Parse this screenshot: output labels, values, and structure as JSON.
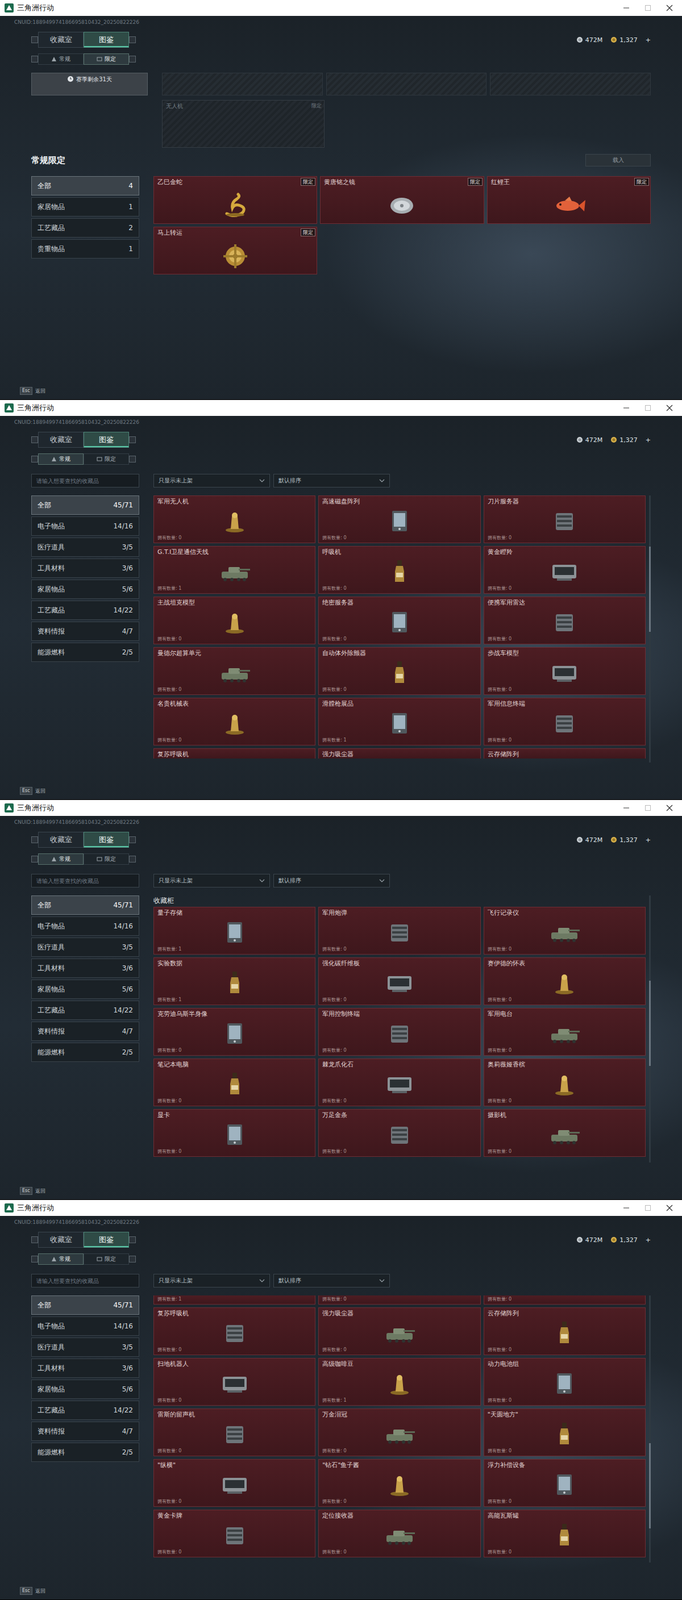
{
  "window": {
    "title": "三角洲行动"
  },
  "screens": [
    {
      "kind": "limited",
      "uid": "CNUID:188949974186695810432_20250822226",
      "tabs": [
        {
          "label": "收藏室",
          "selected": false
        },
        {
          "label": "图鉴",
          "selected": true
        }
      ],
      "subtabs": [
        {
          "label": "常规",
          "selected": false
        },
        {
          "label": "限定",
          "selected": true
        }
      ],
      "currency": [
        {
          "value": "472M"
        },
        {
          "value": "1,327"
        }
      ],
      "add": "+",
      "season": {
        "label": "赛季剩余31天"
      },
      "featured": [
        {
          "name": "无人机",
          "tag": "限定"
        }
      ],
      "section_title": "常规限定",
      "action": "载入",
      "sidebar": [
        {
          "label": "全部",
          "count": "4",
          "selected": true
        },
        {
          "label": "家居物品",
          "count": "1",
          "selected": false
        },
        {
          "label": "工艺藏品",
          "count": "2",
          "selected": false
        },
        {
          "label": "贵重物品",
          "count": "1",
          "selected": false
        }
      ],
      "items": [
        {
          "name": "乙巳金蛇",
          "tag": "限定"
        },
        {
          "name": "黄唐铭之镜",
          "tag": "限定"
        },
        {
          "name": "红鲤王",
          "tag": "限定"
        },
        {
          "name": "马上转运",
          "tag": "限定"
        }
      ],
      "footer": {
        "key": "Esc",
        "label": "返回"
      }
    },
    {
      "kind": "regular",
      "uid": "CNUID:188949974186695810432_20250822226",
      "tabs": [
        {
          "label": "收藏室",
          "selected": false
        },
        {
          "label": "图鉴",
          "selected": true
        }
      ],
      "subtabs": [
        {
          "label": "常规",
          "selected": true
        },
        {
          "label": "限定",
          "selected": false
        }
      ],
      "currency": [
        {
          "value": "472M"
        },
        {
          "value": "1,327"
        }
      ],
      "add": "+",
      "search": {
        "placeholder": "请输入想要查找的收藏品"
      },
      "filters": [
        {
          "value": "只显示未上架"
        },
        {
          "value": "默认排序"
        }
      ],
      "sidebar": [
        {
          "label": "全部",
          "count": "45/71",
          "selected": true
        },
        {
          "label": "电子物品",
          "count": "14/16",
          "selected": false
        },
        {
          "label": "医疗道具",
          "count": "3/5",
          "selected": false
        },
        {
          "label": "工具材料",
          "count": "3/6",
          "selected": false
        },
        {
          "label": "家居物品",
          "count": "5/6",
          "selected": false
        },
        {
          "label": "工艺藏品",
          "count": "14/22",
          "selected": false
        },
        {
          "label": "资料情报",
          "count": "4/7",
          "selected": false
        },
        {
          "label": "能源燃料",
          "count": "2/5",
          "selected": false
        }
      ],
      "section_title": "",
      "top_partial": [],
      "items": [
        {
          "name": "军用无人机",
          "count": "拥有数量: 0"
        },
        {
          "name": "高速磁盘阵列",
          "count": "拥有数量: 0"
        },
        {
          "name": "刀片服务器",
          "count": "拥有数量: 0"
        },
        {
          "name": "G.T.I卫星通信天线",
          "count": "拥有数量: 1"
        },
        {
          "name": "呼吸机",
          "count": "拥有数量: 0"
        },
        {
          "name": "黄金瞪羚",
          "count": "拥有数量: 0"
        },
        {
          "name": "主战坦克模型",
          "count": "拥有数量: 0"
        },
        {
          "name": "绝密服务器",
          "count": "拥有数量: 0"
        },
        {
          "name": "便携军用雷达",
          "count": "拥有数量: 0"
        },
        {
          "name": "曼德尔超算单元",
          "count": "拥有数量: 0"
        },
        {
          "name": "自动体外除颤器",
          "count": "拥有数量: 0"
        },
        {
          "name": "步战车模型",
          "count": "拥有数量: 0"
        },
        {
          "name": "名贵机械表",
          "count": "拥有数量: 0"
        },
        {
          "name": "滑膛枪展品",
          "count": "拥有数量: 1"
        },
        {
          "name": "军用信息终端",
          "count": "拥有数量: 0"
        }
      ],
      "bottom_partial": [
        {
          "name": "复苏呼吸机"
        },
        {
          "name": "强力吸尘器"
        },
        {
          "name": "云存储阵列"
        }
      ],
      "footer": {
        "key": "Esc",
        "label": "返回"
      }
    },
    {
      "kind": "regular",
      "uid": "CNUID:188949974186695810432_20250822226",
      "tabs": [
        {
          "label": "收藏室",
          "selected": false
        },
        {
          "label": "图鉴",
          "selected": true
        }
      ],
      "subtabs": [
        {
          "label": "常规",
          "selected": true
        },
        {
          "label": "限定",
          "selected": false
        }
      ],
      "currency": [
        {
          "value": "472M"
        },
        {
          "value": "1,327"
        }
      ],
      "add": "+",
      "search": {
        "placeholder": "请输入想要查找的收藏品"
      },
      "filters": [
        {
          "value": "只显示未上架"
        },
        {
          "value": "默认排序"
        }
      ],
      "sidebar": [
        {
          "label": "全部",
          "count": "45/71",
          "selected": true
        },
        {
          "label": "电子物品",
          "count": "14/16",
          "selected": false
        },
        {
          "label": "医疗道具",
          "count": "3/5",
          "selected": false
        },
        {
          "label": "工具材料",
          "count": "3/6",
          "selected": false
        },
        {
          "label": "家居物品",
          "count": "5/6",
          "selected": false
        },
        {
          "label": "工艺藏品",
          "count": "14/22",
          "selected": false
        },
        {
          "label": "资料情报",
          "count": "4/7",
          "selected": false
        },
        {
          "label": "能源燃料",
          "count": "2/5",
          "selected": false
        }
      ],
      "section_title": "收藏柜",
      "top_partial": [],
      "items": [
        {
          "name": "量子存储",
          "count": "拥有数量: 1"
        },
        {
          "name": "军用炮弹",
          "count": "拥有数量: 0"
        },
        {
          "name": "飞行记录仪",
          "count": "拥有数量: 0"
        },
        {
          "name": "实验数据",
          "count": "拥有数量: 1"
        },
        {
          "name": "强化碳纤维板",
          "count": "拥有数量: 0"
        },
        {
          "name": "赛伊德的怀表",
          "count": "拥有数量: 0"
        },
        {
          "name": "克劳迪乌斯半身像",
          "count": "拥有数量: 0"
        },
        {
          "name": "军用控制终端",
          "count": "拥有数量: 0"
        },
        {
          "name": "军用电台",
          "count": "拥有数量: 0"
        },
        {
          "name": "笔记本电脑",
          "count": "拥有数量: 0"
        },
        {
          "name": "棘龙爪化石",
          "count": "拥有数量: 0"
        },
        {
          "name": "奥莉薇娅香槟",
          "count": "拥有数量: 0"
        },
        {
          "name": "显卡",
          "count": "拥有数量: 0"
        },
        {
          "name": "万足金条",
          "count": "拥有数量: 0"
        },
        {
          "name": "摄影机",
          "count": "拥有数量: 0"
        }
      ],
      "bottom_partial": [],
      "footer": {
        "key": "Esc",
        "label": "返回"
      }
    },
    {
      "kind": "regular",
      "uid": "CNUID:188949974186695810432_20250822226",
      "tabs": [
        {
          "label": "收藏室",
          "selected": false
        },
        {
          "label": "图鉴",
          "selected": true
        }
      ],
      "subtabs": [
        {
          "label": "常规",
          "selected": true
        },
        {
          "label": "限定",
          "selected": false
        }
      ],
      "currency": [
        {
          "value": "472M"
        },
        {
          "value": "1,327"
        }
      ],
      "add": "+",
      "search": {
        "placeholder": "请输入想要查找的收藏品"
      },
      "filters": [
        {
          "value": "只显示未上架"
        },
        {
          "value": "默认排序"
        }
      ],
      "sidebar": [
        {
          "label": "全部",
          "count": "45/71",
          "selected": true
        },
        {
          "label": "电子物品",
          "count": "14/16",
          "selected": false
        },
        {
          "label": "医疗道具",
          "count": "3/5",
          "selected": false
        },
        {
          "label": "工具材料",
          "count": "3/6",
          "selected": false
        },
        {
          "label": "家居物品",
          "count": "5/6",
          "selected": false
        },
        {
          "label": "工艺藏品",
          "count": "14/22",
          "selected": false
        },
        {
          "label": "资料情报",
          "count": "4/7",
          "selected": false
        },
        {
          "label": "能源燃料",
          "count": "2/5",
          "selected": false
        }
      ],
      "section_title": "",
      "top_partial": [
        {
          "count": "拥有数量: 1"
        },
        {
          "count": "拥有数量: 0"
        },
        {
          "count": "拥有数量: 0"
        }
      ],
      "items": [
        {
          "name": "复苏呼吸机",
          "count": "拥有数量: 0"
        },
        {
          "name": "强力吸尘器",
          "count": "拥有数量: 0"
        },
        {
          "name": "云存储阵列",
          "count": "拥有数量: 0"
        },
        {
          "name": "扫地机器人",
          "count": "拥有数量: 0"
        },
        {
          "name": "高级咖啡豆",
          "count": "拥有数量: 1"
        },
        {
          "name": "动力电池组",
          "count": "拥有数量: 0"
        },
        {
          "name": "雷斯的留声机",
          "count": "拥有数量: 0"
        },
        {
          "name": "万金泪冠",
          "count": "拥有数量: 0"
        },
        {
          "name": "\"天圆地方\"",
          "count": "拥有数量: 0"
        },
        {
          "name": "\"纵横\"",
          "count": "拥有数量: 0"
        },
        {
          "name": "\"钻石\"鱼子酱",
          "count": "拥有数量: 0"
        },
        {
          "name": "浮力补偿设备",
          "count": "拥有数量: 0"
        },
        {
          "name": "黄金卡牌",
          "count": "拥有数量: 0"
        },
        {
          "name": "定位接收器",
          "count": "拥有数量: 0"
        },
        {
          "name": "高能瓦斯罐",
          "count": "拥有数量: 0"
        }
      ],
      "bottom_partial": [],
      "footer": {
        "key": "Esc",
        "label": "返回"
      }
    }
  ]
}
